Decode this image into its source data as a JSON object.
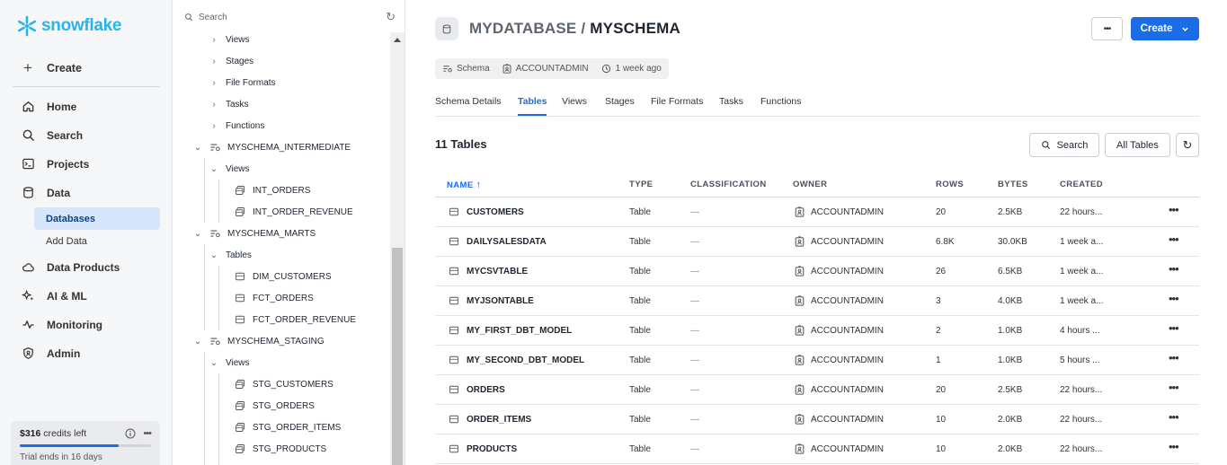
{
  "brand": {
    "name": "snowflake"
  },
  "nav": {
    "create_label": "Create",
    "items": [
      {
        "label": "Home",
        "icon": "home-icon"
      },
      {
        "label": "Search",
        "icon": "search-icon"
      },
      {
        "label": "Projects",
        "icon": "terminal-icon"
      },
      {
        "label": "Data",
        "icon": "database-icon"
      },
      {
        "label": "Data Products",
        "icon": "cloud-icon"
      },
      {
        "label": "AI & ML",
        "icon": "sparkle-icon"
      },
      {
        "label": "Monitoring",
        "icon": "pulse-icon"
      },
      {
        "label": "Admin",
        "icon": "shield-icon"
      }
    ],
    "sub_items": [
      {
        "label": "Databases",
        "active": true
      },
      {
        "label": "Add Data",
        "active": false
      }
    ],
    "credits": {
      "amount": "$316",
      "suffix": "credits left",
      "trial": "Trial ends in 16 days",
      "progress": 0.75
    }
  },
  "tree": {
    "search_placeholder": "Search",
    "rows": [
      {
        "label": "Views",
        "kind": "folder"
      },
      {
        "label": "Stages",
        "kind": "folder"
      },
      {
        "label": "File Formats",
        "kind": "folder"
      },
      {
        "label": "Tasks",
        "kind": "folder"
      },
      {
        "label": "Functions",
        "kind": "folder"
      },
      {
        "label": "MYSCHEMA_INTERMEDIATE",
        "kind": "schema"
      },
      {
        "label": "Views",
        "kind": "folder"
      },
      {
        "label": "INT_ORDERS",
        "kind": "view"
      },
      {
        "label": "INT_ORDER_REVENUE",
        "kind": "view"
      },
      {
        "label": "MYSCHEMA_MARTS",
        "kind": "schema"
      },
      {
        "label": "Tables",
        "kind": "folder"
      },
      {
        "label": "DIM_CUSTOMERS",
        "kind": "table"
      },
      {
        "label": "FCT_ORDERS",
        "kind": "table"
      },
      {
        "label": "FCT_ORDER_REVENUE",
        "kind": "table"
      },
      {
        "label": "MYSCHEMA_STAGING",
        "kind": "schema"
      },
      {
        "label": "Views",
        "kind": "folder"
      },
      {
        "label": "STG_CUSTOMERS",
        "kind": "view"
      },
      {
        "label": "STG_ORDERS",
        "kind": "view"
      },
      {
        "label": "STG_ORDER_ITEMS",
        "kind": "view"
      },
      {
        "label": "STG_PRODUCTS",
        "kind": "view"
      }
    ]
  },
  "header": {
    "database": "MYDATABASE",
    "separator": " / ",
    "schema": "MYSCHEMA",
    "more_label": "•••",
    "create_label": "Create",
    "meta": {
      "type": "Schema",
      "owner": "ACCOUNTADMIN",
      "created": "1 week ago"
    }
  },
  "tabs": [
    "Schema Details",
    "Tables",
    "Views",
    "Stages",
    "File Formats",
    "Tasks",
    "Functions"
  ],
  "table_section": {
    "count_label": "11 Tables",
    "search_label": "Search",
    "filter_label": "All Tables"
  },
  "table": {
    "columns": [
      "NAME",
      "TYPE",
      "CLASSIFICATION",
      "OWNER",
      "ROWS",
      "BYTES",
      "CREATED"
    ],
    "sort_indicator": "↑",
    "rows": [
      {
        "name": "CUSTOMERS",
        "type": "Table",
        "classification": "—",
        "owner": "ACCOUNTADMIN",
        "rows": "20",
        "bytes": "2.5KB",
        "created": "22 hours..."
      },
      {
        "name": "DAILYSALESDATA",
        "type": "Table",
        "classification": "—",
        "owner": "ACCOUNTADMIN",
        "rows": "6.8K",
        "bytes": "30.0KB",
        "created": "1 week a..."
      },
      {
        "name": "MYCSVTABLE",
        "type": "Table",
        "classification": "—",
        "owner": "ACCOUNTADMIN",
        "rows": "26",
        "bytes": "6.5KB",
        "created": "1 week a..."
      },
      {
        "name": "MYJSONTABLE",
        "type": "Table",
        "classification": "—",
        "owner": "ACCOUNTADMIN",
        "rows": "3",
        "bytes": "4.0KB",
        "created": "1 week a..."
      },
      {
        "name": "MY_FIRST_DBT_MODEL",
        "type": "Table",
        "classification": "—",
        "owner": "ACCOUNTADMIN",
        "rows": "2",
        "bytes": "1.0KB",
        "created": "4 hours ..."
      },
      {
        "name": "MY_SECOND_DBT_MODEL",
        "type": "Table",
        "classification": "—",
        "owner": "ACCOUNTADMIN",
        "rows": "1",
        "bytes": "1.0KB",
        "created": "5 hours ..."
      },
      {
        "name": "ORDERS",
        "type": "Table",
        "classification": "—",
        "owner": "ACCOUNTADMIN",
        "rows": "20",
        "bytes": "2.5KB",
        "created": "22 hours..."
      },
      {
        "name": "ORDER_ITEMS",
        "type": "Table",
        "classification": "—",
        "owner": "ACCOUNTADMIN",
        "rows": "10",
        "bytes": "2.0KB",
        "created": "22 hours..."
      },
      {
        "name": "PRODUCTS",
        "type": "Table",
        "classification": "—",
        "owner": "ACCOUNTADMIN",
        "rows": "10",
        "bytes": "2.0KB",
        "created": "22 hours..."
      }
    ],
    "row_more_label": "•••"
  },
  "colors": {
    "accent": "#1a6ce7",
    "brand": "#29b5e8",
    "active_nav_bg": "#d8e6fb"
  }
}
